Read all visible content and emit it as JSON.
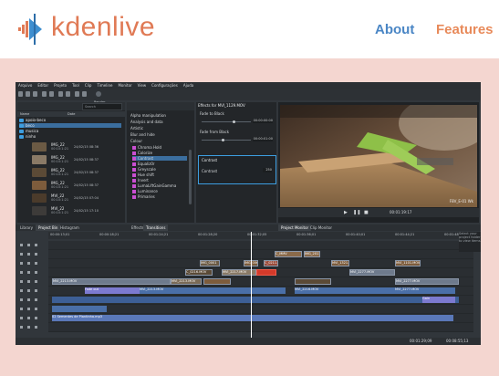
{
  "site": {
    "brand": "kdenlive",
    "nav": [
      {
        "label": "About"
      },
      {
        "label": "Features"
      }
    ],
    "colors": {
      "brand_orange": "#e07a55",
      "about_blue": "#4a86c5",
      "features_orange": "#e88a5a",
      "background": "#f4d6d0"
    }
  },
  "app": {
    "menu": [
      "Arquivo",
      "Editar",
      "Projeto",
      "Tool",
      "Clip",
      "Timeline",
      "Monitor",
      "View",
      "Configurações",
      "Ajuda"
    ],
    "toolbar": {
      "render_label": "Render"
    },
    "bin": {
      "search_placeholder": "Search",
      "columns": {
        "name": "Name",
        "date": "Date"
      },
      "folders": [
        "apoio-beco",
        "beco",
        "musica",
        "ninho"
      ],
      "selected_folder": "beco",
      "clips": [
        {
          "name": "IMG_22",
          "duration": "00:10:1:21",
          "date": "24/02/15 08:36"
        },
        {
          "name": "IMG_22",
          "duration": "00:10:1:21",
          "date": "24/02/15 08:37"
        },
        {
          "name": "IMG_22",
          "duration": "00:10:1:21",
          "date": "24/02/15 08:37"
        },
        {
          "name": "IMG_22",
          "duration": "00:10:1:21",
          "date": "24/02/15 08:37"
        },
        {
          "name": "MVI_22",
          "duration": "00:10:1:21",
          "date": "24/02/15 07:04"
        },
        {
          "name": "MVI_22",
          "duration": "00:10:1:21",
          "date": "24/02/15 17:10"
        }
      ]
    },
    "effects": {
      "categories": [
        "Alpha manipulation",
        "Analysis and data",
        "Artistic",
        "Blur and hide",
        "Colour"
      ],
      "items": [
        {
          "label": "Chroma Hold",
          "color": "#c94fd1"
        },
        {
          "label": "Colorize",
          "color": "#c94fd1"
        },
        {
          "label": "Contrast",
          "color": "#c94fd1"
        },
        {
          "label": "Equaliz0r",
          "color": "#c94fd1"
        },
        {
          "label": "Greyscale",
          "color": "#c94fd1"
        },
        {
          "label": "Hue shift",
          "color": "#c94fd1"
        },
        {
          "label": "Invert",
          "color": "#c94fd1"
        },
        {
          "label": "LumaLiftGainGamma",
          "color": "#c94fd1"
        },
        {
          "label": "Luminance",
          "color": "#c94fd1"
        },
        {
          "label": "Primaries",
          "color": "#c94fd1"
        }
      ],
      "selected": "Contrast"
    },
    "effect_stack": {
      "title": "Effects for MVI_1129.MOV",
      "fade_to_black": {
        "label": "Fade to Black",
        "value": "00:00:00:00"
      },
      "fade_from_black": {
        "label": "Fade from Black",
        "value": "00:00:01:00"
      },
      "contrast": {
        "label": "Contrast",
        "param": "Contrast",
        "value": "250"
      }
    },
    "monitor": {
      "overlay": "F8V_E-01 Wk",
      "timecode": "00:01:19:17"
    },
    "tabs": [
      "Library",
      "Project Bin",
      "Histogram",
      "Effects",
      "Transitions",
      "Project Monitor",
      "Clip Monitor"
    ],
    "timeline": {
      "ruler": [
        "00:00:13;01",
        "00:00:18;21",
        "00:01:24;21",
        "00:01:28;20",
        "00:01:32;05",
        "00:01:36;01",
        "00:01:40;01",
        "00:01:44;21",
        "00:01:48"
      ],
      "clips": {
        "v1": "MVI_2213.MOV",
        "v2": "MVI_2213.MOV",
        "c1": "IMG_0001",
        "c2": "C_0216.MOV",
        "c3": "IMG_0060",
        "c4": "C_0211.MOV",
        "c5": "C_MMV",
        "c6": "IMG_2011",
        "c7": "MVI_1101.MOV",
        "c8": "MVI_2277.MOV",
        "c9": "MVI_2217.MOV",
        "c10": "MVI_1321.MOV",
        "c11": "Fade out",
        "c12": "Gain",
        "audio1": "MVI_2213.MOV",
        "audio2": "MVI_2216.MOV",
        "audio3": "MVI_2277.MOV",
        "music": "02 Sementes de Plantinha.mp3"
      },
      "side_note": "Select your project folder to view items"
    },
    "status": {
      "timecode": "00:01:29;09",
      "duration": "00:08:55;13"
    }
  }
}
